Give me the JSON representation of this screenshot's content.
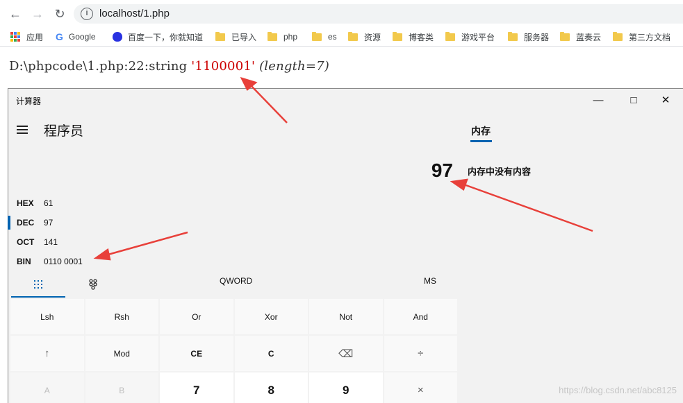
{
  "browser": {
    "url": "localhost/1.php",
    "bookmarks": [
      "应用",
      "Google",
      "百度一下，你就知道",
      "已导入",
      "php",
      "es",
      "资源",
      "博客类",
      "游戏平台",
      "服务器",
      "蓝奏云",
      "第三方文档"
    ]
  },
  "php_output": {
    "prefix": "D:\\phpcode\\1.php:22:string",
    "string_value": "'1100001'",
    "length": "(length=7)"
  },
  "calculator": {
    "window_title": "计算器",
    "mode": "程序员",
    "memory_tab": "内存",
    "memory_empty": "内存中没有内容",
    "display": "97",
    "radix": [
      {
        "name": "HEX",
        "value": "61",
        "selected": false
      },
      {
        "name": "DEC",
        "value": "97",
        "selected": true
      },
      {
        "name": "OCT",
        "value": "141",
        "selected": false
      },
      {
        "name": "BIN",
        "value": "0110 0001",
        "selected": false
      }
    ],
    "word_size": "QWORD",
    "ms_label": "MS",
    "keys": [
      {
        "label": "Lsh",
        "style": ""
      },
      {
        "label": "Rsh",
        "style": ""
      },
      {
        "label": "Or",
        "style": ""
      },
      {
        "label": "Xor",
        "style": ""
      },
      {
        "label": "Not",
        "style": ""
      },
      {
        "label": "And",
        "style": ""
      },
      {
        "label": "↑",
        "style": "op"
      },
      {
        "label": "Mod",
        "style": ""
      },
      {
        "label": "CE",
        "style": "bold"
      },
      {
        "label": "C",
        "style": "bold"
      },
      {
        "label": "⌫",
        "style": "op"
      },
      {
        "label": "÷",
        "style": "op"
      },
      {
        "label": "A",
        "style": "dim"
      },
      {
        "label": "B",
        "style": "dim"
      },
      {
        "label": "7",
        "style": "num"
      },
      {
        "label": "8",
        "style": "num"
      },
      {
        "label": "9",
        "style": "num"
      },
      {
        "label": "×",
        "style": "op"
      }
    ]
  },
  "watermark": "https://blog.csdn.net/abc8125",
  "colors": {
    "accent": "#0063b1",
    "annotation_arrow": "#e8403a",
    "php_string": "#cc0000"
  }
}
